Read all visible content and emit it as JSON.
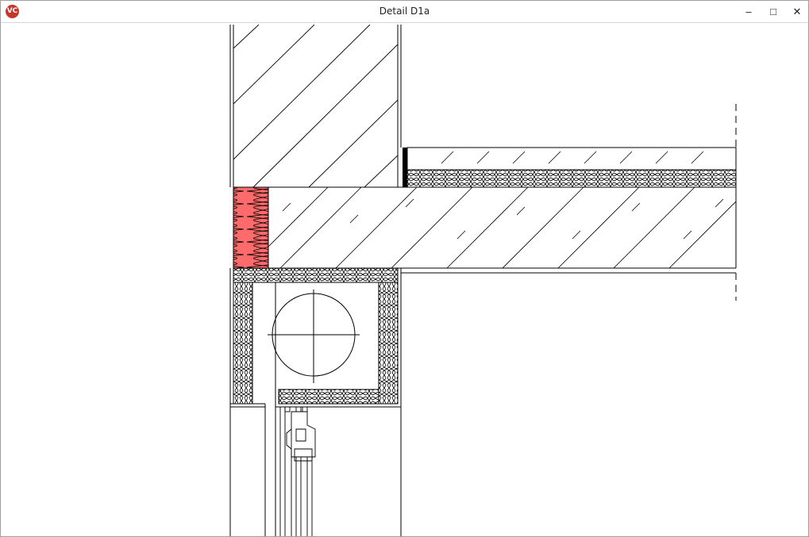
{
  "window": {
    "title": "Detail D1a",
    "app_icon": "vc-app-icon",
    "controls": {
      "minimize": "–",
      "maximize": "□",
      "close": "✕"
    }
  },
  "drawing": {
    "colors": {
      "line": "#000000",
      "highlight_insulation": "#ff6b6b",
      "background": "#ffffff"
    }
  }
}
